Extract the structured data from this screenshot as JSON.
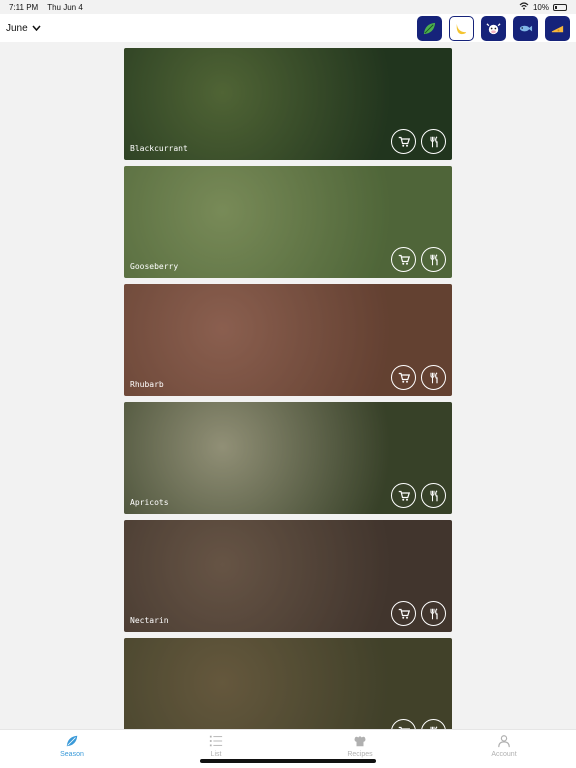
{
  "status": {
    "time": "7:11 PM",
    "date": "Thu Jun 4",
    "battery": "10%"
  },
  "header": {
    "month": "June"
  },
  "filters": [
    {
      "icon": "leaf-icon",
      "selected": false
    },
    {
      "icon": "banana-icon",
      "selected": true
    },
    {
      "icon": "cow-icon",
      "selected": false
    },
    {
      "icon": "fish-icon",
      "selected": false
    },
    {
      "icon": "cheese-icon",
      "selected": false
    }
  ],
  "items": [
    {
      "name": "Blackcurrant",
      "colors": [
        "#2f4a2a",
        "#6f8b4a"
      ]
    },
    {
      "name": "Gooseberry",
      "colors": [
        "#6e8d4f",
        "#a7c07a"
      ]
    },
    {
      "name": "Rhubarb",
      "colors": [
        "#8a5a45",
        "#c0846e"
      ]
    },
    {
      "name": "Apricots",
      "colors": [
        "#4d5a38",
        "#c9c7a4"
      ]
    },
    {
      "name": "Nectarin",
      "colors": [
        "#5b4a3f",
        "#8e7560"
      ]
    },
    {
      "name": "",
      "colors": [
        "#5a5a3a",
        "#8c7a55"
      ]
    }
  ],
  "tabs": [
    {
      "label": "Season",
      "active": true
    },
    {
      "label": "List",
      "active": false
    },
    {
      "label": "Recipes",
      "active": false
    },
    {
      "label": "Account",
      "active": false
    }
  ]
}
